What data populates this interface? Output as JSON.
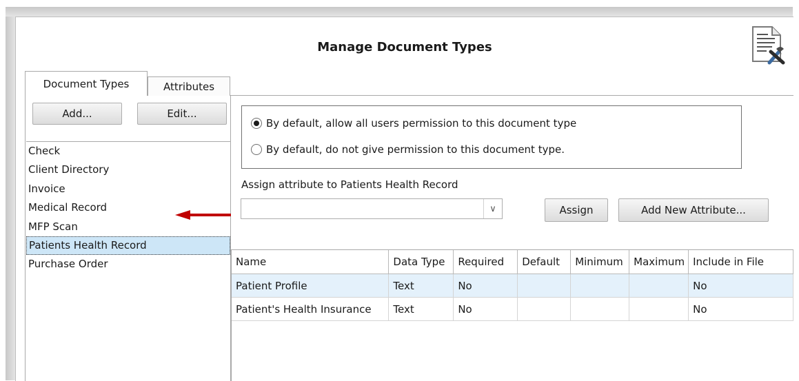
{
  "dialog": {
    "title": "Manage Document Types"
  },
  "tabs": [
    {
      "label": "Document Types",
      "active": true
    },
    {
      "label": "Attributes",
      "active": false
    }
  ],
  "left": {
    "add_label": "Add...",
    "edit_label": "Edit...",
    "document_types": [
      "Check",
      "Client Directory",
      "Invoice",
      "Medical Record",
      "MFP Scan",
      "Patients Health Record",
      "Purchase Order"
    ],
    "selected": "Patients Health Record"
  },
  "permissions": {
    "option_allow": "By default, allow all users permission to this document type",
    "option_deny": "By default, do not give permission to this document type.",
    "selected": "allow"
  },
  "assign": {
    "label": "Assign attribute to Patients Health Record",
    "combo_value": "",
    "assign_label": "Assign",
    "add_new_label": "Add New Attribute..."
  },
  "grid": {
    "columns": [
      "Name",
      "Data Type",
      "Required",
      "Default",
      "Minimum",
      "Maximum",
      "Include in File"
    ],
    "rows": [
      {
        "name": "Patient Profile",
        "data_type": "Text",
        "required": "No",
        "default": "",
        "minimum": "",
        "maximum": "",
        "include": "No"
      },
      {
        "name": "Patient's Health Insurance",
        "data_type": "Text",
        "required": "No",
        "default": "",
        "minimum": "",
        "maximum": "",
        "include": "No"
      }
    ]
  },
  "colors": {
    "selection": "#cde6f7",
    "row_selection": "#e4f1fb",
    "arrow": "#c00000"
  }
}
